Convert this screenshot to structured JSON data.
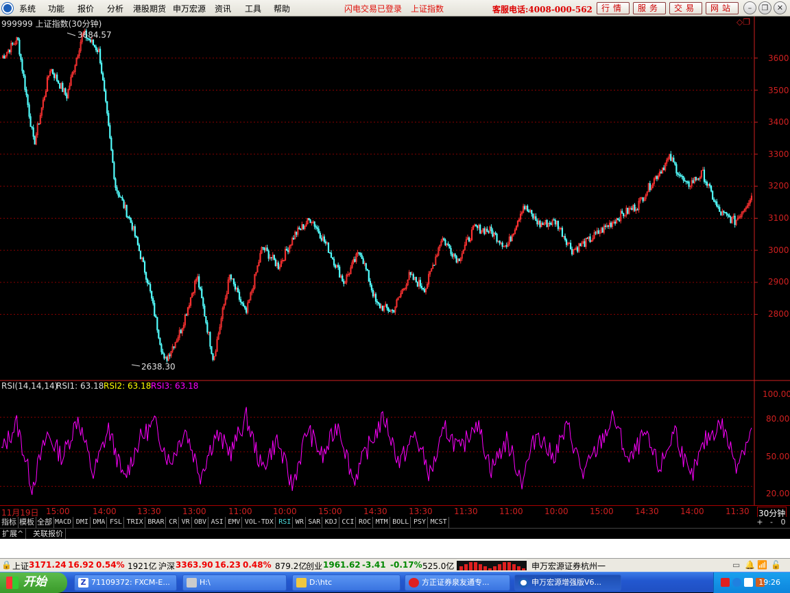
{
  "menu": {
    "items": [
      "系统",
      "功能",
      "报价",
      "分析",
      "港股期货",
      "申万宏源",
      "资讯",
      "工具",
      "帮助"
    ],
    "status_login": "闪电交易已登录",
    "status_index": "上证指数",
    "hotline": "客服电话:4008-000-562",
    "quick_buttons": [
      "行情",
      "服务",
      "交易",
      "网站"
    ]
  },
  "chart": {
    "title": "999999 上证指数(30分钟)",
    "high_label": "3684.57",
    "low_label": "2638.30",
    "price_ticks": [
      "3600",
      "3500",
      "3400",
      "3300",
      "3200",
      "3100",
      "3000",
      "2900",
      "2800"
    ],
    "rsi_header": {
      "name": "RSI(14,14,14)",
      "rsi1": "RSI1: 63.18",
      "rsi2": "RSI2: 63.18",
      "rsi3": "RSI3: 63.18"
    },
    "rsi_ticks": [
      "100.00",
      "80.00",
      "50.00",
      "20.00"
    ],
    "colors": {
      "up": "#ff3232",
      "down": "#54ffff",
      "rsi": "#ff00ff",
      "grid": "#8b0000",
      "axis": "#d02020",
      "rsi2": "#ffff00"
    }
  },
  "chart_data": {
    "type": "line",
    "title": "999999 上证指数(30分钟)",
    "price_range": [
      2638.3,
      3684.57
    ],
    "price_series_keypoints": [
      3600,
      3660,
      3330,
      3570,
      3480,
      3680,
      3620,
      3200,
      3080,
      2900,
      2650,
      2750,
      2920,
      2660,
      2920,
      2800,
      3010,
      2950,
      3050,
      3100,
      3010,
      2900,
      3000,
      2830,
      2810,
      2920,
      2880,
      3040,
      2970,
      3070,
      3060,
      3010,
      3140,
      3080,
      3090,
      3000,
      3030,
      3070,
      3110,
      3140,
      3220,
      3290,
      3200,
      3240,
      3120,
      3090,
      3170
    ],
    "rsi_series_keypoints": [
      50,
      75,
      20,
      65,
      45,
      80,
      30,
      70,
      25,
      60,
      75,
      40,
      70,
      30,
      65,
      50,
      80,
      35,
      60,
      20,
      70,
      45,
      75,
      25,
      55,
      80,
      40,
      65,
      30,
      70,
      50,
      78,
      35,
      60,
      25,
      68,
      45,
      72,
      30,
      55,
      80,
      40,
      65,
      35,
      70,
      25,
      60,
      75,
      40,
      68
    ],
    "rsi_range": [
      0,
      100
    ],
    "x_labels": [
      "11月19日",
      "15:00",
      "14:00",
      "13:30",
      "13:00",
      "11:00",
      "10:00",
      "15:00",
      "14:30",
      "13:30",
      "11:30",
      "11:00",
      "10:00",
      "15:00",
      "14:30",
      "14:00",
      "11:30"
    ],
    "x_unit": "30分钟"
  },
  "indicator_tabs": [
    "指标",
    "模板",
    "全部",
    "MACD",
    "DMI",
    "DMA",
    "FSL",
    "TRIX",
    "BRAR",
    "CR",
    "VR",
    "OBV",
    "ASI",
    "EMV",
    "VOL-TDX",
    "RSI",
    "WR",
    "SAR",
    "KDJ",
    "CCI",
    "ROC",
    "MTM",
    "BOLL",
    "PSY",
    "MCST"
  ],
  "indicator_active": "RSI",
  "tab_controls": [
    "+",
    "-",
    "0"
  ],
  "ext_tabs": [
    "扩展^",
    "关联报价"
  ],
  "statusbar": {
    "sh_label": "上证",
    "sh_value": "3171.24",
    "sh_change": "16.92",
    "sh_pct": "0.54%",
    "sh_amount": "1921亿",
    "hs_label": "沪深",
    "hs_value": "3363.90",
    "hs_change": "16.23",
    "hs_pct": "0.48%",
    "hs_amount": "879.2亿",
    "cy_label": "创业",
    "cy_value": "1961.62",
    "cy_change": "-3.41",
    "cy_pct": "-0.17%",
    "cy_amount": "525.0亿",
    "broker": "申万宏源证券杭州一"
  },
  "taskbar": {
    "start": "开始",
    "tasks": [
      "71109372: FXCM-E...",
      "H:\\",
      "D:\\htc",
      "方正证券泉友通专...",
      "申万宏源增强版V6..."
    ],
    "clock": "19:26"
  }
}
